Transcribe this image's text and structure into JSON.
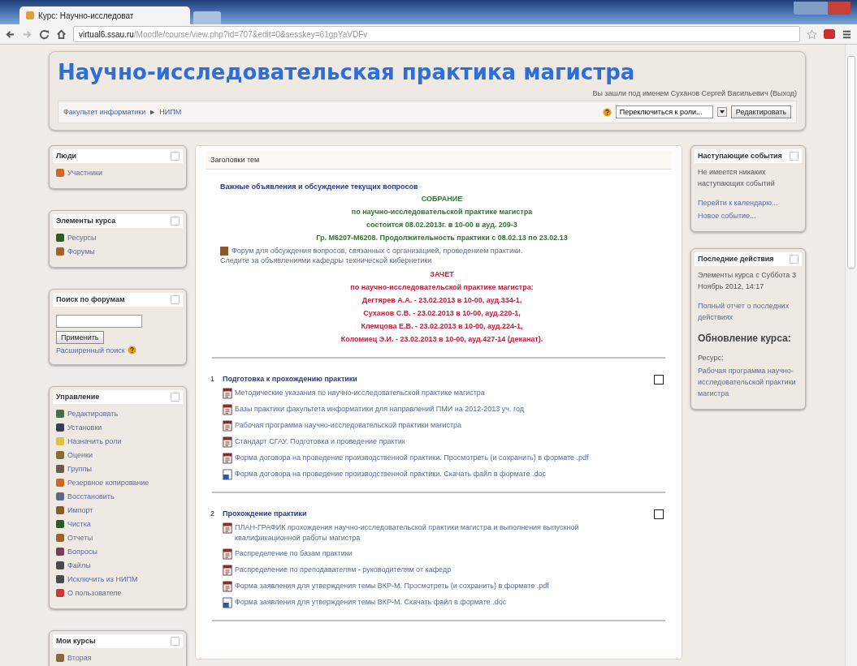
{
  "browser": {
    "tab_title": "Курс: Научно-исследоват",
    "url_host": "virtual6.ssau.ru",
    "url_path": "/Moodle/course/view.php?id=707&edit=0&sesskey=61gpYaVDFv"
  },
  "header": {
    "title": "Научно-исследовательская практика магистра",
    "login_info": "Вы зашли под именем Суханов Сергей Васильевич (Выход)",
    "breadcrumb": [
      "Факультет информатики",
      "НИПМ"
    ],
    "breadcrumb_sep": "►",
    "role_select": "Переключиться к роли...",
    "edit_button": "Редактировать"
  },
  "left_blocks": [
    {
      "kind": "links",
      "title": "Люди",
      "items": [
        "Участники"
      ]
    },
    {
      "kind": "links",
      "title": "Элементы курса",
      "items": [
        "Ресурсы",
        "Форумы"
      ]
    },
    {
      "kind": "search",
      "title": "Поиск по форумам",
      "button": "Применить",
      "link": "Расширенный поиск"
    },
    {
      "kind": "links",
      "title": "Управление",
      "items": [
        "Редактировать",
        "Установки",
        "Назначить роли",
        "Оценки",
        "Группы",
        "Резервное копирование",
        "Восстановить",
        "Импорт",
        "Чистка",
        "Отчеты",
        "Вопросы",
        "Файлы",
        "Исключить из НИПМ",
        "О пользователе"
      ]
    },
    {
      "kind": "links",
      "title": "Мои курсы",
      "items": [
        "Вторая"
      ]
    }
  ],
  "topics": {
    "title": "Заголовки тем",
    "intro": {
      "link": "Важные объявления и обсуждение текущих вопросов",
      "notice": [
        "СОБРАНИЕ",
        "по научно-исследовательской практике магистра",
        "состоится 08.02.2013г. в 10-00 в ауд. 209-3",
        "Гр. М6207-М6208. Продолжительность практики с 08.02.13 по 23.02.13"
      ],
      "forum": "Форум для обсуждения вопросов, связанных с организацией, проведением практики.",
      "note": "Следите за объявлениями кафедры технической кибернетики",
      "exam": [
        "ЗАЧЕТ",
        "по научно-исследовательской практике магистра:",
        "Дегтярев А.А. - 23.02.2013 в 10-00, ауд.334-1,",
        "Суханов С.В. - 23.02.2013 в 10-00, ауд.220-1,",
        "Клемцова Е.В. - 23.02.2013 в 10-00, ауд.224-1,",
        "Коломиец Э.И. - 23.02.2013 в 10-00, ауд.427-14 (деканат)."
      ]
    },
    "sections": [
      {
        "number": "1",
        "title": "Подготовка к прохождению практики",
        "items": [
          {
            "kind": "pdf",
            "text": "Методические указания по научно-исследовательской практике магистра"
          },
          {
            "kind": "pdf",
            "text": "Базы практики факультета информатики для направлений ПМИ на 2012-2013 уч. год"
          },
          {
            "kind": "pdf",
            "text": "Рабочая программа научно-исследовательской практики магистра"
          },
          {
            "kind": "pdf",
            "text": "Стандарт СГАУ. Подготовка и проведение практик"
          },
          {
            "kind": "pdf",
            "text": "Форма договора на проведение производственной практики. Просмотреть (и сохранить) в формате .pdf"
          },
          {
            "kind": "doc",
            "text": "Форма договора на проведение производственной практики. Скачать файл в формате .doc"
          }
        ]
      },
      {
        "number": "2",
        "title": "Прохождение практики",
        "items": [
          {
            "kind": "pdf",
            "text": "ПЛАН-ГРАФИК прохождения научно-исследовательской практики магистра и выполнения выпускной квалификационной работы магистра"
          },
          {
            "kind": "pdf",
            "text": "Распределение по базам практики"
          },
          {
            "kind": "pdf",
            "text": "Распределение по преподавателям - руководителям от кафедр"
          },
          {
            "kind": "pdf",
            "text": "Форма заявления для утверждения темы ВКР-М. Просмотреть (и сохранить) в формате .pdf"
          },
          {
            "kind": "doc",
            "text": "Форма заявления для утверждения темы ВКР-М. Скачать файл в формате .doc"
          }
        ]
      }
    ]
  },
  "right_blocks": [
    {
      "title": "Наступающие события",
      "text": "Не имеется никаких наступающих событий",
      "links": [
        "Перейти к календарю...",
        "Новое событие..."
      ]
    },
    {
      "title": "Последние действия",
      "text": "Элементы курса с Суббота 3 Ноябрь 2012, 14:17",
      "links": [
        "Полный отчет о последних действиях"
      ],
      "subheading": "Обновление курса:",
      "update_label": "Ресурс:",
      "update_link": "Рабочая программа научно-исследовательской практики магистра"
    }
  ]
}
